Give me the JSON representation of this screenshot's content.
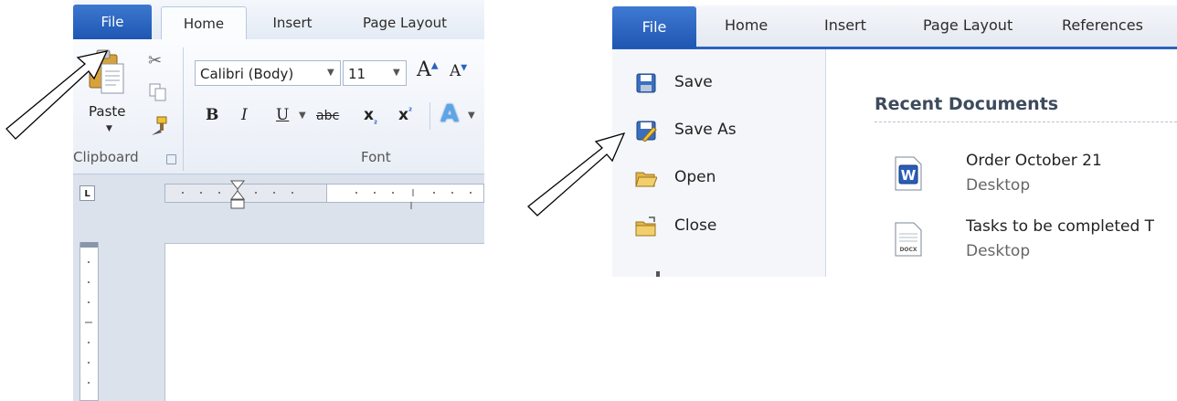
{
  "left": {
    "tabs": {
      "file": "File",
      "home": "Home",
      "insert": "Insert",
      "page_layout": "Page Layout"
    },
    "clipboard": {
      "paste_label": "Paste",
      "group_label": "Clipboard"
    },
    "font": {
      "font_name": "Calibri (Body)",
      "font_size": "11",
      "group_label": "Font",
      "bold": "B",
      "italic": "I",
      "underline": "U",
      "strike": "abc",
      "subscript": "x",
      "superscript": "x",
      "grow": "A",
      "shrink": "A"
    },
    "ruler": {
      "tab_selector": "L"
    }
  },
  "right": {
    "tabs": {
      "file": "File",
      "home": "Home",
      "insert": "Insert",
      "page_layout": "Page Layout",
      "references": "References"
    },
    "menu": [
      {
        "label": "Save",
        "icon": "save-icon"
      },
      {
        "label": "Save As",
        "icon": "save-as-icon"
      },
      {
        "label": "Open",
        "icon": "open-folder-icon"
      },
      {
        "label": "Close",
        "icon": "close-folder-icon"
      }
    ],
    "recent": {
      "title": "Recent Documents",
      "docs": [
        {
          "name": "Order October 21",
          "location": "Desktop",
          "icon": "word-doc-icon"
        },
        {
          "name": "Tasks to be completed T",
          "location": "Desktop",
          "icon": "docx-icon"
        }
      ]
    }
  },
  "colors": {
    "file_tab": "#2a63bd",
    "ribbon_bg": "#e9eef6",
    "backstage_menu": "#f4f6fa"
  }
}
